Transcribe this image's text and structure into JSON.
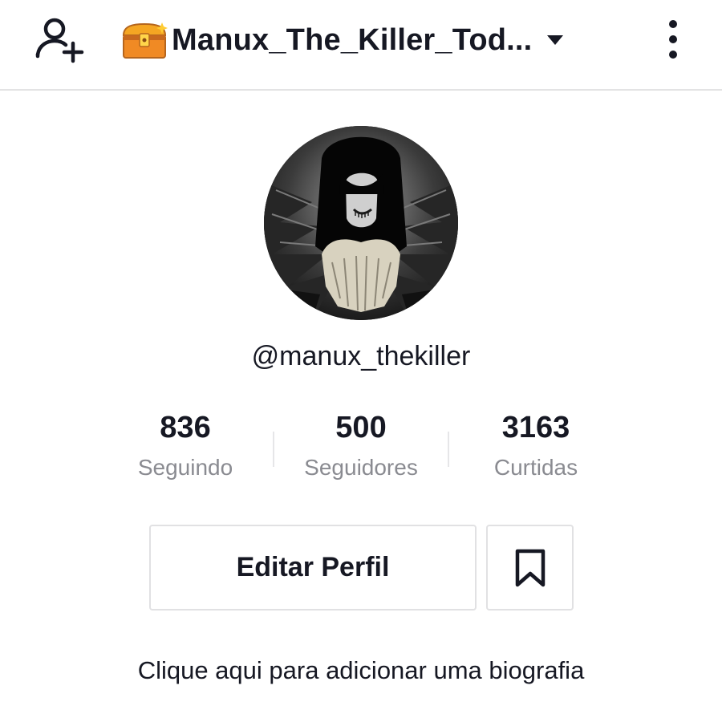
{
  "header": {
    "add_user_icon": "person-add-icon",
    "emoji_icon": "treasure-chest-icon",
    "title": "Manux_The_Killer_Tod...",
    "dropdown_icon": "caret-down-icon",
    "menu_icon": "more-vertical-icon"
  },
  "profile": {
    "avatar": "avatar-image",
    "username": "@manux_thekiller"
  },
  "stats": [
    {
      "value": "836",
      "label": "Seguindo"
    },
    {
      "value": "500",
      "label": "Seguidores"
    },
    {
      "value": "3163",
      "label": "Curtidas"
    }
  ],
  "actions": {
    "edit_profile_label": "Editar Perfil",
    "bookmark_icon": "bookmark-icon"
  },
  "bio": {
    "prompt": "Clique aqui para adicionar uma biografia"
  },
  "colors": {
    "text_primary": "#161823",
    "text_secondary": "#8a8b91",
    "border": "#e1e1e3"
  }
}
